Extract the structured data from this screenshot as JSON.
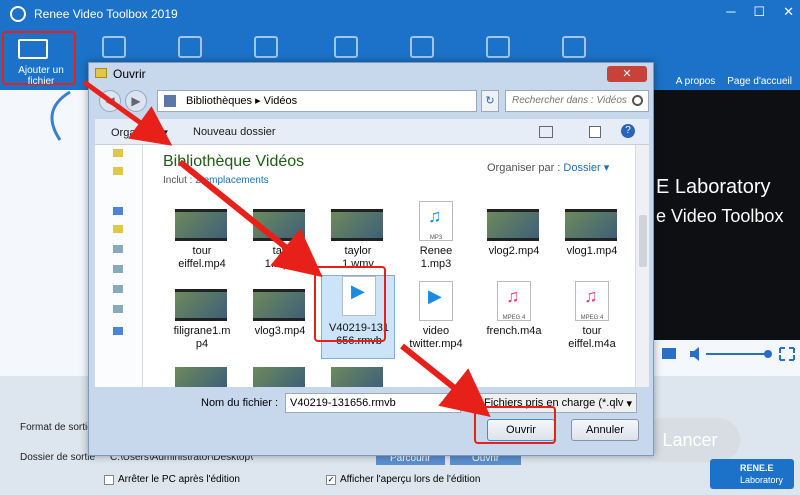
{
  "app": {
    "title": "Renee Video Toolbox 2019",
    "window_controls": [
      "─",
      "☐",
      "✕"
    ],
    "add_file_label": "Ajouter un fichier",
    "about_label": "A propos",
    "home_label": "Page d'accueil"
  },
  "preview": {
    "line1": "E Laboratory",
    "line2": "e Video Toolbox"
  },
  "bottom": {
    "format_label": "Format de sortie",
    "folder_label": "Dossier de sortie",
    "folder_value": "C:\\Users\\Administrator\\Desktop\\",
    "browse_label": "Parcourir",
    "open_label": "Ouvrir",
    "shutdown_label": "Arrêter le PC après l'édition",
    "preview_check_label": "Afficher l'aperçu lors de l'édition",
    "launch_label": "Lancer",
    "brand_top": "RENE.E",
    "brand_bottom": "Laboratory"
  },
  "dialog": {
    "title": "Ouvrir",
    "close": "✕",
    "breadcrumb": "Bibliothèques  ▸  Vidéos",
    "search_placeholder": "Rechercher dans : Vidéos",
    "organize_label": "Organiser ▾",
    "new_folder_label": "Nouveau dossier",
    "library_title": "Bibliothèque Vidéos",
    "includes_prefix": "Inclut : ",
    "includes_value": "2 emplacements",
    "arrange_prefix": "Organiser par : ",
    "arrange_value": "Dossier ▾",
    "filename_label": "Nom du fichier :",
    "filename_value": "V40219-131656.rmvb",
    "filetype_value": "Fichiers pris en charge (*.qlv",
    "open_btn": "Ouvrir",
    "cancel_btn": "Annuler"
  },
  "files": [
    {
      "name": "tour\neiffel.mp4",
      "kind": "video"
    },
    {
      "name": "tay\n1.mp4",
      "kind": "video"
    },
    {
      "name": "taylor\n1.wmv",
      "kind": "video"
    },
    {
      "name": "Renee\n1.mp3",
      "kind": "audio",
      "tag": "MP3"
    },
    {
      "name": "vlog2.mp4",
      "kind": "video"
    },
    {
      "name": "vlog1.mp4",
      "kind": "video"
    },
    {
      "name": "filigrane1.m\np4",
      "kind": "video"
    },
    {
      "name": "vlog3.mp4",
      "kind": "video"
    },
    {
      "name": "V40219-131\n656.rmvb",
      "kind": "media",
      "selected": true
    },
    {
      "name": "video\ntwitter.mp4",
      "kind": "media"
    },
    {
      "name": "french.m4a",
      "kind": "audio",
      "tag": "MPEG 4"
    },
    {
      "name": "tour\neiffel.m4a",
      "kind": "audio",
      "tag": "MPEG 4"
    }
  ],
  "colors": {
    "accent": "#1c72c8",
    "highlight": "#e8201a",
    "library_title": "#1c5d14"
  }
}
